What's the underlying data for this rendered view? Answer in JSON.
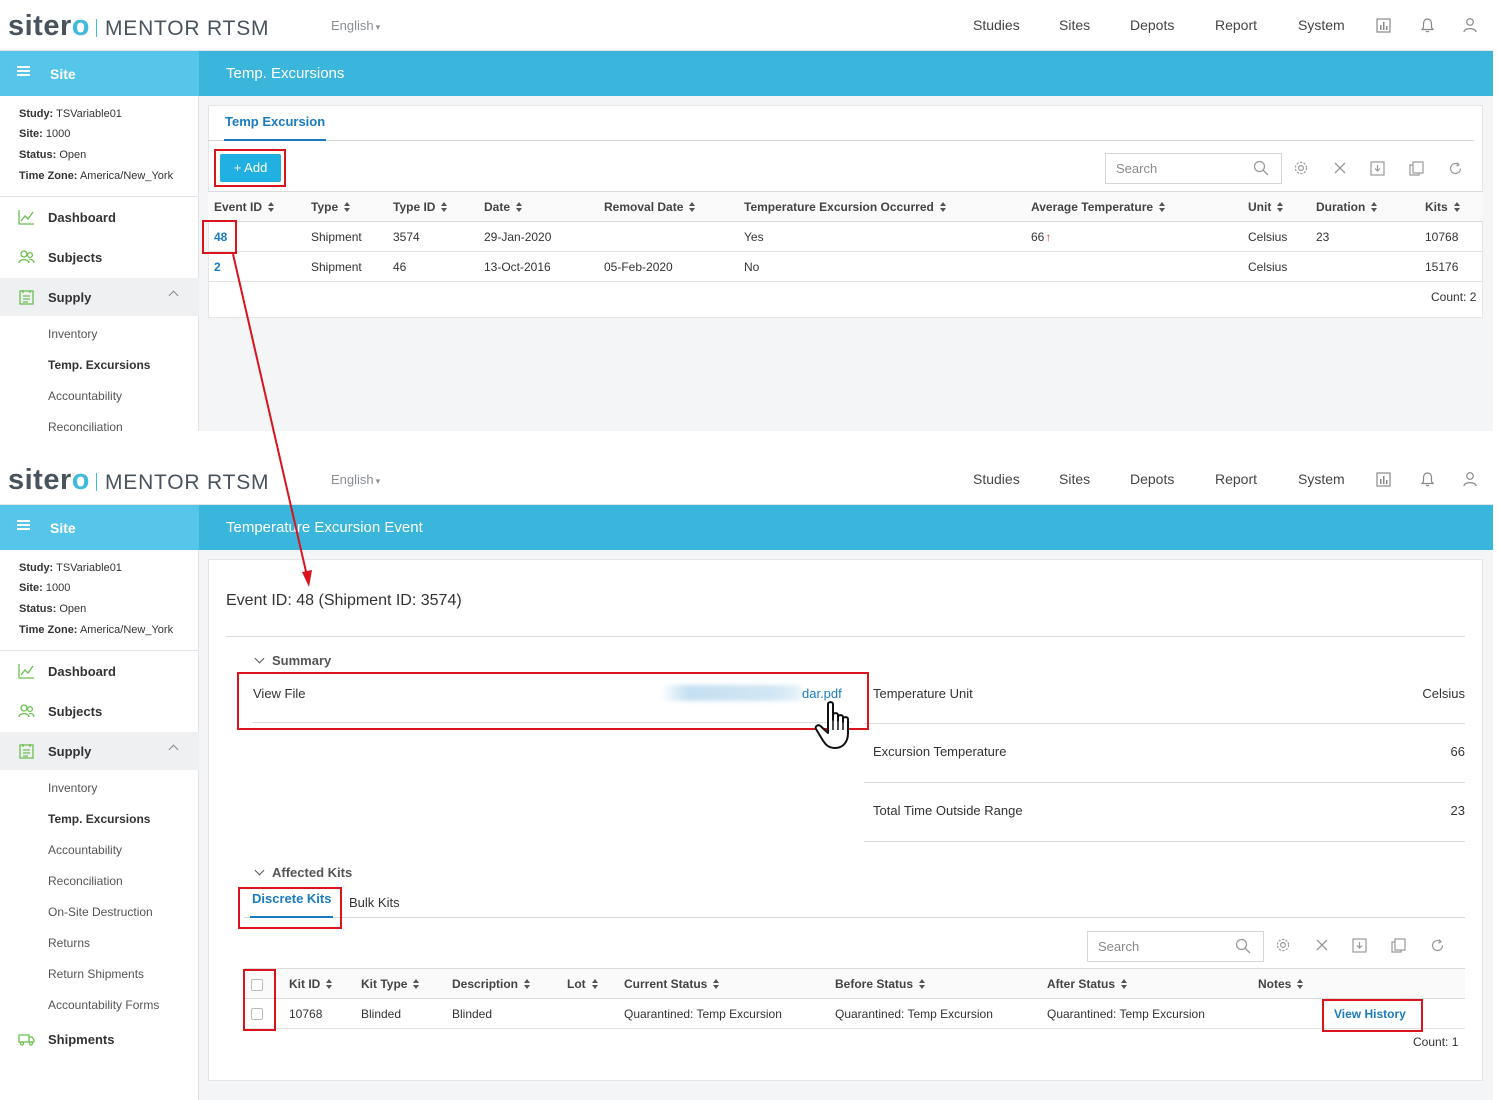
{
  "brand": {
    "logo_main": "siter",
    "logo_o": "o",
    "logo_product": "MENTOR RTSM"
  },
  "topbar": {
    "language": "English",
    "nav": [
      "Studies",
      "Sites",
      "Depots",
      "Report",
      "System"
    ],
    "icons": [
      "report-chart-icon",
      "bell-icon",
      "user-icon"
    ]
  },
  "sidebar": {
    "header": "Site",
    "study_label": "Study:",
    "study": "TSVariable01",
    "site_label": "Site:",
    "site": "1000",
    "status_label": "Status:",
    "status": "Open",
    "tz_label": "Time Zone:",
    "tz": "America/New_York",
    "dashboard": "Dashboard",
    "subjects": "Subjects",
    "supply": "Supply",
    "supply_items": [
      "Inventory",
      "Temp. Excursions",
      "Accountability",
      "Reconciliation",
      "On-Site Destruction",
      "Returns",
      "Return Shipments",
      "Accountability Forms"
    ],
    "shipments": "Shipments"
  },
  "screen1": {
    "page_title": "Temp. Excursions",
    "tab": "Temp Excursion",
    "add_label": "+ Add",
    "search_placeholder": "Search",
    "columns": [
      "Event ID",
      "Type",
      "Type ID",
      "Date",
      "Removal Date",
      "Temperature Excursion Occurred",
      "Average Temperature",
      "Unit",
      "Duration",
      "Kits"
    ],
    "rows": [
      {
        "event_id": "48",
        "type": "Shipment",
        "type_id": "3574",
        "date": "29-Jan-2020",
        "removal_date": "",
        "occurred": "Yes",
        "avg_temp": "66",
        "avg_temp_trend": "up",
        "unit": "Celsius",
        "duration": "23",
        "kits": "10768"
      },
      {
        "event_id": "2",
        "type": "Shipment",
        "type_id": "46",
        "date": "13-Oct-2016",
        "removal_date": "05-Feb-2020",
        "occurred": "No",
        "avg_temp": "",
        "unit": "Celsius",
        "duration": "",
        "kits": "15176"
      }
    ],
    "count": "Count: 2"
  },
  "screen2": {
    "page_title": "Temperature Excursion Event",
    "event_title": "Event ID: 48 (Shipment ID: 3574)",
    "summary_label": "Summary",
    "view_file_label": "View File",
    "view_file_link": "dar.pdf",
    "temp_unit_label": "Temperature Unit",
    "temp_unit": "Celsius",
    "excursion_temp_label": "Excursion Temperature",
    "excursion_temp": "66",
    "time_outside_label": "Total Time Outside Range",
    "time_outside": "23",
    "affected_kits_label": "Affected Kits",
    "tabs": [
      "Discrete Kits",
      "Bulk Kits"
    ],
    "search_placeholder": "Search",
    "columns": [
      "Kit ID",
      "Kit Type",
      "Description",
      "Lot",
      "Current Status",
      "Before Status",
      "After Status",
      "Notes"
    ],
    "rows": [
      {
        "kit_id": "10768",
        "kit_type": "Blinded",
        "description": "Blinded",
        "lot": "",
        "current_status": "Quarantined: Temp Excursion",
        "before_status": "Quarantined: Temp Excursion",
        "after_status": "Quarantined: Temp Excursion",
        "action": "View History"
      }
    ],
    "count": "Count: 1"
  },
  "colors": {
    "accent": "#3ab5dc",
    "sidebar_header": "#55c5e9",
    "link": "#1a7cc0",
    "highlight": "#d9141c",
    "add_button": "#21b0e2"
  }
}
